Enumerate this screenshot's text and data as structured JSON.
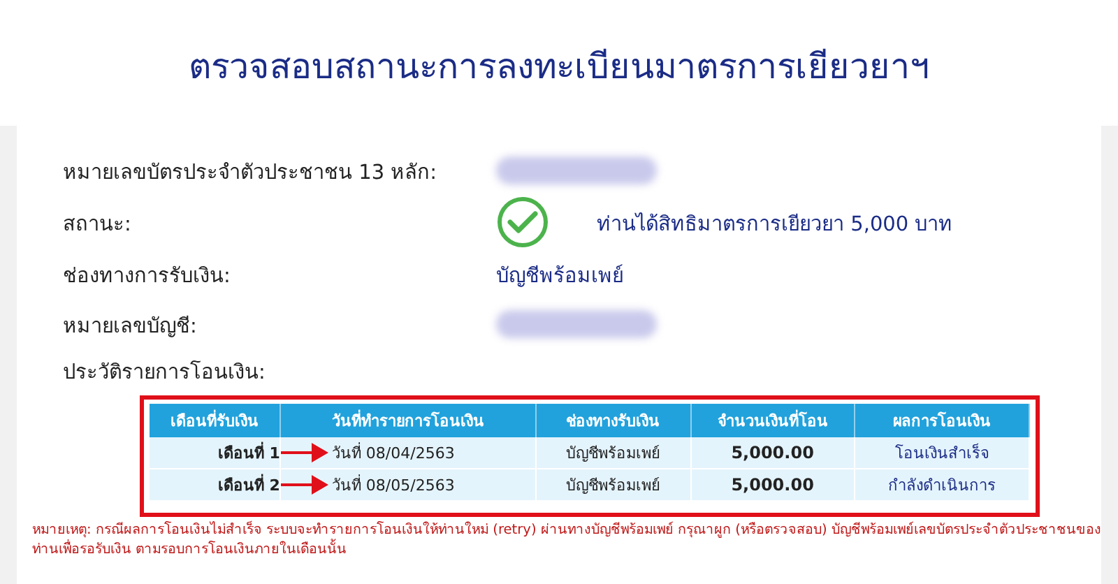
{
  "title": "ตรวจสอบสถานะการลงทะเบียนมาตรการเยียวยาฯ",
  "fields": [
    {
      "label": "หมายเลขบัตรประจำตัวประชาชน 13 หลัก:",
      "kind": "redacted"
    },
    {
      "label": "สถานะ:",
      "kind": "status",
      "value": "ท่านได้สิทธิมาตรการเยียวยา 5,000 บาท"
    },
    {
      "label": "ช่องทางการรับเงิน:",
      "kind": "text",
      "value": "บัญชีพร้อมเพย์"
    },
    {
      "label": "หมายเลขบัญชี:",
      "kind": "redacted"
    }
  ],
  "history_label": "ประวัติรายการโอนเงิน:",
  "table": {
    "columns": [
      "เดือนที่รับเงิน",
      "วันที่ทำรายการโอนเงิน",
      "ช่องทางรับเงิน",
      "จำนวนเงินที่โอน",
      "ผลการโอนเงิน"
    ],
    "rows": [
      {
        "month": "เดือนที่ 1",
        "date": "วันที่ 08/04/2563",
        "channel": "บัญชีพร้อมเพย์",
        "amount": "5,000.00",
        "result": "โอนเงินสำเร็จ"
      },
      {
        "month": "เดือนที่ 2",
        "date": "วันที่ 08/05/2563",
        "channel": "บัญชีพร้อมเพย์",
        "amount": "5,000.00",
        "result": "กำลังดำเนินการ"
      }
    ]
  },
  "note": "หมายเหตุ: กรณีผลการโอนเงินไม่สำเร็จ ระบบจะทำรายการโอนเงินให้ท่านใหม่ (retry) ผ่านทางบัญชีพร้อมเพย์ กรุณาผูก (หรือตรวจสอบ) บัญชีพร้อมเพย์เลขบัตรประจำตัวประชาชนของท่านเพื่อรอรับเงิน ตามรอบการโอนเงินภายในเดือนนั้น"
}
